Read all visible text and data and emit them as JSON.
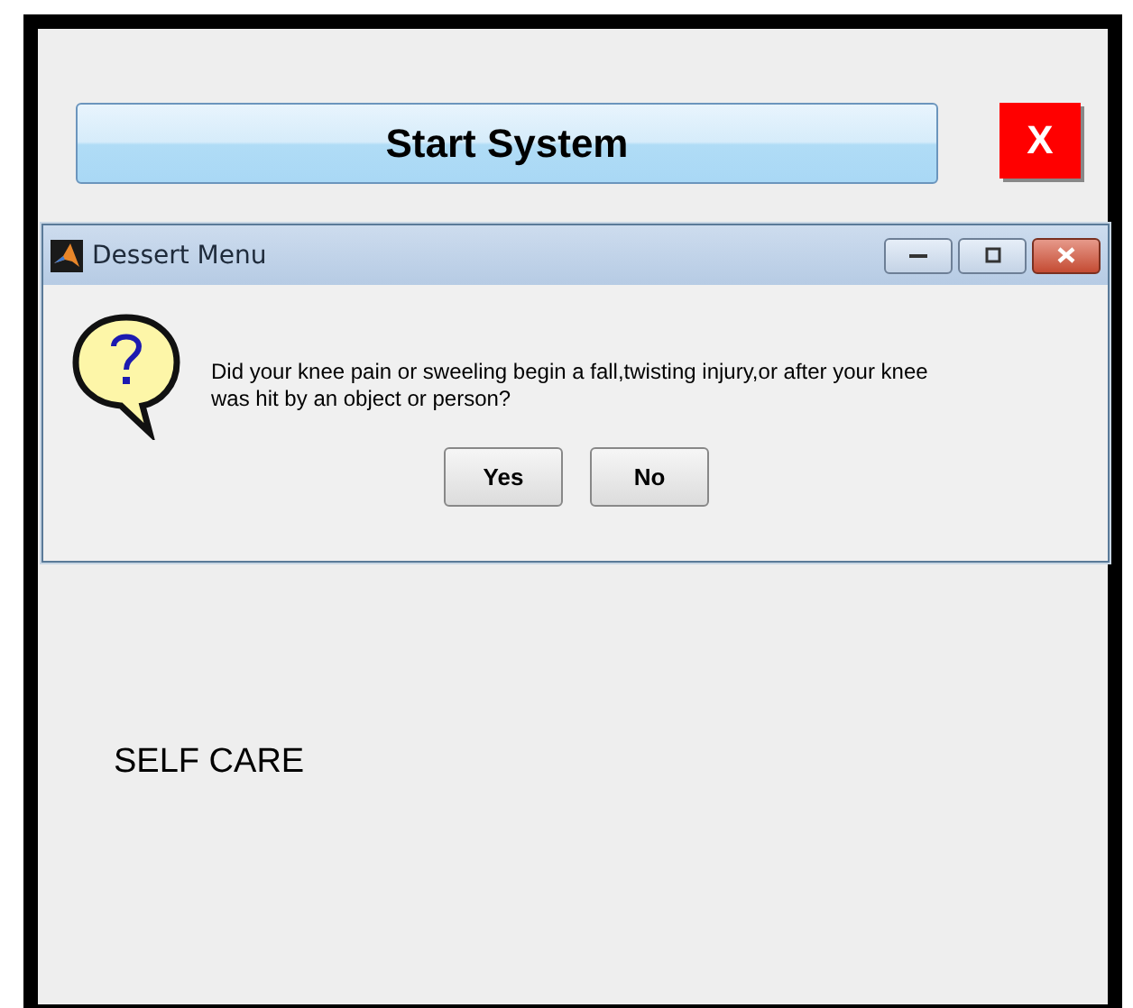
{
  "app": {
    "start_button": "Start System",
    "close_button": "X",
    "label": "SELF CARE"
  },
  "dialog": {
    "title": "Dessert Menu",
    "message": "Did your knee pain or sweeling begin a fall,twisting injury,or after your knee  was hit by an object or person?",
    "buttons": [
      "Yes",
      "No"
    ]
  }
}
